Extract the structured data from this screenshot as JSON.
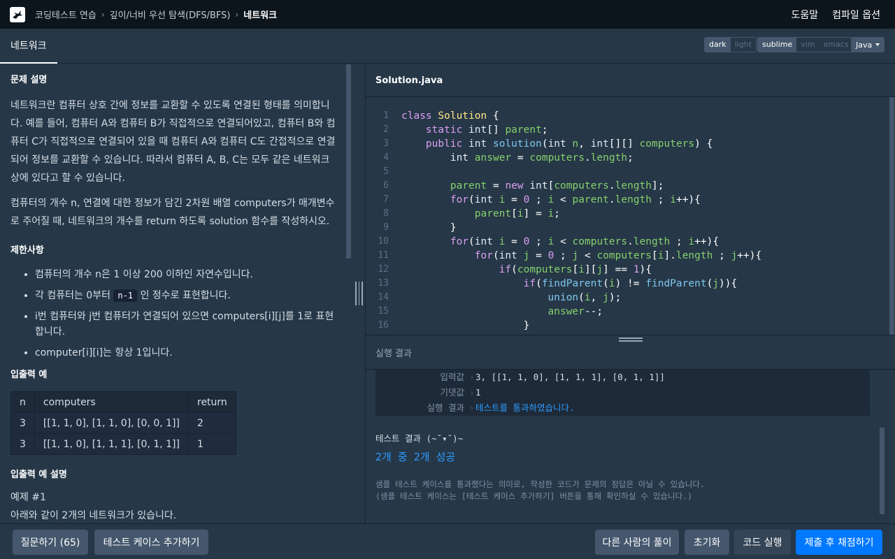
{
  "nav": {
    "breadcrumbs": [
      "코딩테스트 연습",
      "깊이/너비 우선 탐색(DFS/BFS)",
      "네트워크"
    ],
    "help": "도움말",
    "compile_options": "컴파일 옵션"
  },
  "title_tab": "네트워크",
  "theme_toggle": [
    "dark",
    "light"
  ],
  "keymap_toggle": [
    "sublime",
    "vim",
    "emacs"
  ],
  "language": "Java",
  "problem": {
    "h_desc": "문제 설명",
    "p1": "네트워크란 컴퓨터 상호 간에 정보를 교환할 수 있도록 연결된 형태를 의미합니다. 예를 들어, 컴퓨터 A와 컴퓨터 B가 직접적으로 연결되어있고, 컴퓨터 B와 컴퓨터 C가 직접적으로 연결되어 있을 때 컴퓨터 A와 컴퓨터 C도 간접적으로 연결되어 정보를 교환할 수 있습니다. 따라서 컴퓨터 A, B, C는 모두 같은 네트워크 상에 있다고 할 수 있습니다.",
    "p2": "컴퓨터의 개수 n, 연결에 대한 정보가 담긴 2차원 배열 computers가 매개변수로 주어질 때, 네트워크의 개수를 return 하도록 solution 함수를 작성하시오.",
    "h_limits": "제한사항",
    "limit1": "컴퓨터의 개수 n은 1 이상 200 이하인 자연수입니다.",
    "limit2_a": "각 컴퓨터는 0부터",
    "limit2_code": "n-1",
    "limit2_b": "인 정수로 표현합니다.",
    "limit3": "i번 컴퓨터와 j번 컴퓨터가 연결되어 있으면 computers[i][j]를 1로 표현합니다.",
    "limit4": "computer[i][i]는 항상 1입니다.",
    "h_io": "입출력 예",
    "io_headers": [
      "n",
      "computers",
      "return"
    ],
    "io_rows": [
      [
        "3",
        "[[1, 1, 0], [1, 1, 0], [0, 0, 1]]",
        "2"
      ],
      [
        "3",
        "[[1, 1, 0], [1, 1, 1], [0, 1, 1]]",
        "1"
      ]
    ],
    "h_io_desc": "입출력 예 설명",
    "example1": "예제 #1",
    "example1_text": "아래와 같이 2개의 네트워크가 있습니다."
  },
  "editor": {
    "filename": "Solution.java",
    "line_numbers": [
      "1",
      "2",
      "3",
      "4",
      "5",
      "6",
      "7",
      "8",
      "9",
      "10",
      "11",
      "12",
      "13",
      "14",
      "15",
      "16"
    ]
  },
  "results": {
    "header": "실행 결과",
    "rows": [
      {
        "key": "입력값",
        "value": "3, [[1, 1, 0], [1, 1, 1], [0, 1, 1]]"
      },
      {
        "key": "기댓값",
        "value": "1"
      },
      {
        "key": "실행 결과",
        "value": "테스트를 통과하였습니다."
      }
    ],
    "summary_title": "테스트 결과 (~˘▾˘)~",
    "summary_result": "2개 중 2개 성공",
    "note": "샘플 테스트 케이스를 통과했다는 의미로, 작성한 코드가 문제의 정답은 아닐 수 있습니다.\n(샘플 테스트 케이스는 [테스트 케이스 추가하기] 버튼을 통해 확인하실 수 있습니다.)"
  },
  "buttons": {
    "ask": "질문하기 (65)",
    "add_testcase": "테스트 케이스 추가하기",
    "others_solution": "다른 사람의 풀이",
    "reset": "초기화",
    "run": "코드 실행",
    "submit": "제출 후 채점하기"
  }
}
